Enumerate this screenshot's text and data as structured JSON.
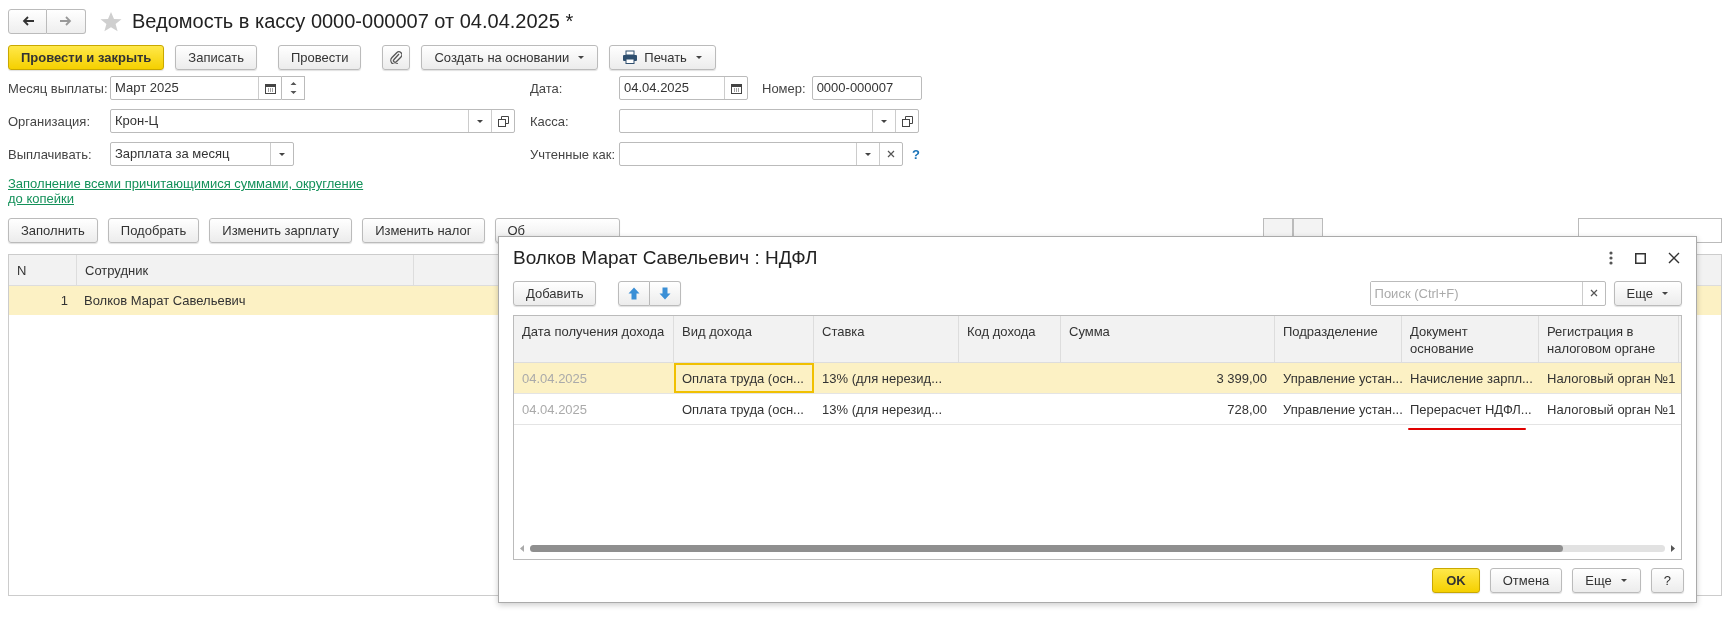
{
  "window": {
    "title": "Ведомость в кассу 0000-000007 от 04.04.2025 *",
    "favorite": false
  },
  "nav": [
    {
      "kind": "back",
      "disabled": false
    },
    {
      "kind": "forward",
      "disabled": true
    }
  ],
  "toolbar": [
    {
      "kind": "primary",
      "label": "Провести и закрыть"
    },
    {
      "kind": "plain",
      "label": "Записать"
    },
    {
      "kind": "plain",
      "label": "Провести"
    },
    {
      "kind": "attach"
    },
    {
      "kind": "menu",
      "label": "Создать на основании"
    },
    {
      "kind": "print-menu",
      "label": "Печать"
    }
  ],
  "form": {
    "left": [
      {
        "kind": "month",
        "label": "Месяц выплаты:",
        "value": "Март 2025"
      },
      {
        "kind": "select-open",
        "label": "Организация:",
        "value": "Крон-Ц"
      },
      {
        "kind": "select",
        "label": "Выплачивать:",
        "value": "Зарплата за месяц"
      }
    ],
    "right": [
      {
        "kind": "date",
        "label": "Дата:",
        "value": "04.04.2025",
        "number_label": "Номер:",
        "number": "0000-000007"
      },
      {
        "kind": "select-open",
        "label": "Касса:"
      },
      {
        "kind": "select-clear",
        "label": "Учтенные как:",
        "help": "?"
      }
    ]
  },
  "fill_link": "Заполнение всеми причитающимися суммами, округление до копейки",
  "table_buttons": [
    "Заполнить",
    "Подобрать",
    "Изменить зарплату",
    "Изменить налог",
    "Об"
  ],
  "table": {
    "columns": [
      "N",
      "Сотрудник"
    ],
    "rows": [
      {
        "selected": true,
        "cells": [
          "1",
          "Волков Марат Савельевич"
        ]
      }
    ]
  },
  "dialog": {
    "title": "Волков Марат Савельевич : НДФЛ",
    "add_button": "Добавить",
    "search": {
      "placeholder": "Поиск (Ctrl+F)"
    },
    "more_button": "Еще",
    "columns": [
      "Дата получения дохода",
      "Вид дохода",
      "Ставка",
      "Код дохода",
      "Сумма",
      "Подразделение",
      "Документ основание",
      "Регистрация в налоговом органе"
    ],
    "rows": [
      {
        "selected": true,
        "cells": [
          {
            "text": "04.04.2025",
            "dim": true,
            "focused": false,
            "underlined": false
          },
          {
            "text": "Оплата труда (осн...",
            "dim": false,
            "focused": true,
            "underlined": false
          },
          {
            "text": "13% (для нерезид...",
            "dim": false,
            "focused": false,
            "underlined": false
          },
          {},
          {
            "text": "3 399,00",
            "dim": false,
            "focused": false,
            "underlined": false
          },
          {
            "text": "Управление устан...",
            "dim": false,
            "focused": false,
            "underlined": false
          },
          {
            "text": "Начисление зарпл...",
            "dim": false,
            "focused": false,
            "underlined": false
          },
          {
            "text": "Налоговый орган №1",
            "dim": false,
            "focused": false,
            "underlined": false
          }
        ]
      },
      {
        "selected": false,
        "cells": [
          {
            "text": "04.04.2025",
            "dim": true,
            "focused": false,
            "underlined": false
          },
          {
            "text": "Оплата труда (осн...",
            "dim": false,
            "focused": false,
            "underlined": false
          },
          {
            "text": "13% (для нерезид...",
            "dim": false,
            "focused": false,
            "underlined": false
          },
          {},
          {
            "text": "728,00",
            "dim": false,
            "focused": false,
            "underlined": false
          },
          {
            "text": "Управление устан...",
            "dim": false,
            "focused": false,
            "underlined": false
          },
          {
            "text": "Перерасчет НДФЛ...",
            "dim": false,
            "focused": false,
            "underlined": true
          },
          {
            "text": "Налоговый орган №1",
            "dim": false,
            "focused": false,
            "underlined": false
          }
        ]
      }
    ],
    "footer": [
      {
        "kind": "primary",
        "label": "OK"
      },
      {
        "kind": "plain",
        "label": "Отмена"
      },
      {
        "kind": "menu",
        "label": "Еще"
      },
      {
        "kind": "plain",
        "label": "?"
      }
    ]
  }
}
